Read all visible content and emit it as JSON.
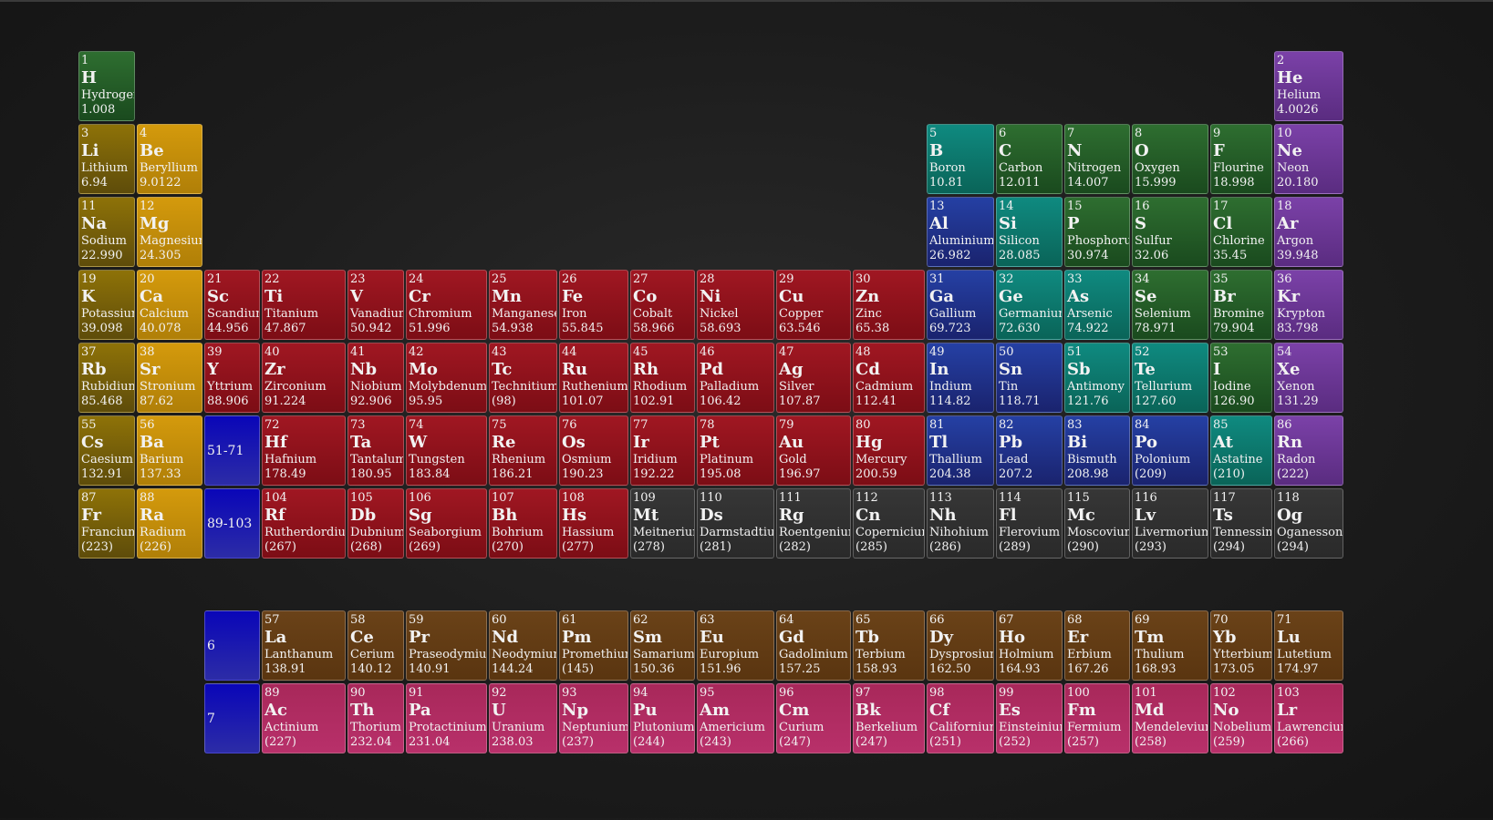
{
  "colors": {
    "alkali": "#7a620a",
    "alkaline": "#c48c0a",
    "transition": "#8e1219",
    "post": "#1f2d8a",
    "metalloid": "#0d7a6e",
    "nonmetal": "#245c26",
    "noble": "#6a3694",
    "unknown": "#303030",
    "lanthanide": "#603c14",
    "actinide": "#b02c62",
    "placeholder": "#1a18b0"
  },
  "placeholders": [
    {
      "id": "lanthanides-range",
      "label": "51-71",
      "row": 6,
      "col": 3
    },
    {
      "id": "actinides-range",
      "label": "89-103",
      "row": 7,
      "col": 3
    },
    {
      "id": "lanthanide-row",
      "label": "6",
      "row": 9,
      "col": 3
    },
    {
      "id": "actinide-row",
      "label": "7",
      "row": 10,
      "col": 3
    }
  ],
  "elements": [
    {
      "n": "1",
      "s": "H",
      "name": "Hydrogen",
      "m": "1.008",
      "row": 1,
      "col": 1,
      "cat": "nonmetal"
    },
    {
      "n": "2",
      "s": "He",
      "name": "Helium",
      "m": "4.0026",
      "row": 1,
      "col": 18,
      "cat": "noble"
    },
    {
      "n": "3",
      "s": "Li",
      "name": "Lithium",
      "m": "6.94",
      "row": 2,
      "col": 1,
      "cat": "alkali"
    },
    {
      "n": "4",
      "s": "Be",
      "name": "Beryllium",
      "m": "9.0122",
      "row": 2,
      "col": 2,
      "cat": "alkaline"
    },
    {
      "n": "5",
      "s": "B",
      "name": "Boron",
      "m": "10.81",
      "row": 2,
      "col": 13,
      "cat": "metalloid"
    },
    {
      "n": "6",
      "s": "C",
      "name": "Carbon",
      "m": "12.011",
      "row": 2,
      "col": 14,
      "cat": "nonmetal"
    },
    {
      "n": "7",
      "s": "N",
      "name": "Nitrogen",
      "m": "14.007",
      "row": 2,
      "col": 15,
      "cat": "nonmetal"
    },
    {
      "n": "8",
      "s": "O",
      "name": "Oxygen",
      "m": "15.999",
      "row": 2,
      "col": 16,
      "cat": "nonmetal"
    },
    {
      "n": "9",
      "s": "F",
      "name": "Flourine",
      "m": "18.998",
      "row": 2,
      "col": 17,
      "cat": "nonmetal"
    },
    {
      "n": "10",
      "s": "Ne",
      "name": "Neon",
      "m": "20.180",
      "row": 2,
      "col": 18,
      "cat": "noble"
    },
    {
      "n": "11",
      "s": "Na",
      "name": "Sodium",
      "m": "22.990",
      "row": 3,
      "col": 1,
      "cat": "alkali"
    },
    {
      "n": "12",
      "s": "Mg",
      "name": "Magnesium",
      "m": "24.305",
      "row": 3,
      "col": 2,
      "cat": "alkaline"
    },
    {
      "n": "13",
      "s": "Al",
      "name": "Aluminium",
      "m": "26.982",
      "row": 3,
      "col": 13,
      "cat": "post"
    },
    {
      "n": "14",
      "s": "Si",
      "name": "Silicon",
      "m": "28.085",
      "row": 3,
      "col": 14,
      "cat": "metalloid"
    },
    {
      "n": "15",
      "s": "P",
      "name": "Phosphorus",
      "m": "30.974",
      "row": 3,
      "col": 15,
      "cat": "nonmetal"
    },
    {
      "n": "16",
      "s": "S",
      "name": "Sulfur",
      "m": "32.06",
      "row": 3,
      "col": 16,
      "cat": "nonmetal"
    },
    {
      "n": "17",
      "s": "Cl",
      "name": "Chlorine",
      "m": "35.45",
      "row": 3,
      "col": 17,
      "cat": "nonmetal"
    },
    {
      "n": "18",
      "s": "Ar",
      "name": "Argon",
      "m": "39.948",
      "row": 3,
      "col": 18,
      "cat": "noble"
    },
    {
      "n": "19",
      "s": "K",
      "name": "Potassium",
      "m": "39.098",
      "row": 4,
      "col": 1,
      "cat": "alkali"
    },
    {
      "n": "20",
      "s": "Ca",
      "name": "Calcium",
      "m": "40.078",
      "row": 4,
      "col": 2,
      "cat": "alkaline"
    },
    {
      "n": "21",
      "s": "Sc",
      "name": "Scandium",
      "m": "44.956",
      "row": 4,
      "col": 3,
      "cat": "transition"
    },
    {
      "n": "22",
      "s": "Ti",
      "name": "Titanium",
      "m": "47.867",
      "row": 4,
      "col": 4,
      "cat": "transition"
    },
    {
      "n": "23",
      "s": "V",
      "name": "Vanadium",
      "m": "50.942",
      "row": 4,
      "col": 5,
      "cat": "transition"
    },
    {
      "n": "24",
      "s": "Cr",
      "name": "Chromium",
      "m": "51.996",
      "row": 4,
      "col": 6,
      "cat": "transition"
    },
    {
      "n": "25",
      "s": "Mn",
      "name": "Manganese",
      "m": "54.938",
      "row": 4,
      "col": 7,
      "cat": "transition"
    },
    {
      "n": "26",
      "s": "Fe",
      "name": "Iron",
      "m": "55.845",
      "row": 4,
      "col": 8,
      "cat": "transition"
    },
    {
      "n": "27",
      "s": "Co",
      "name": "Cobalt",
      "m": "58.966",
      "row": 4,
      "col": 9,
      "cat": "transition"
    },
    {
      "n": "28",
      "s": "Ni",
      "name": "Nickel",
      "m": "58.693",
      "row": 4,
      "col": 10,
      "cat": "transition"
    },
    {
      "n": "29",
      "s": "Cu",
      "name": "Copper",
      "m": "63.546",
      "row": 4,
      "col": 11,
      "cat": "transition"
    },
    {
      "n": "30",
      "s": "Zn",
      "name": "Zinc",
      "m": "65.38",
      "row": 4,
      "col": 12,
      "cat": "transition"
    },
    {
      "n": "31",
      "s": "Ga",
      "name": "Gallium",
      "m": "69.723",
      "row": 4,
      "col": 13,
      "cat": "post"
    },
    {
      "n": "32",
      "s": "Ge",
      "name": "Germanium",
      "m": "72.630",
      "row": 4,
      "col": 14,
      "cat": "metalloid"
    },
    {
      "n": "33",
      "s": "As",
      "name": "Arsenic",
      "m": "74.922",
      "row": 4,
      "col": 15,
      "cat": "metalloid"
    },
    {
      "n": "34",
      "s": "Se",
      "name": "Selenium",
      "m": "78.971",
      "row": 4,
      "col": 16,
      "cat": "nonmetal"
    },
    {
      "n": "35",
      "s": "Br",
      "name": "Bromine",
      "m": "79.904",
      "row": 4,
      "col": 17,
      "cat": "nonmetal"
    },
    {
      "n": "36",
      "s": "Kr",
      "name": "Krypton",
      "m": "83.798",
      "row": 4,
      "col": 18,
      "cat": "noble"
    },
    {
      "n": "37",
      "s": "Rb",
      "name": "Rubidium",
      "m": "85.468",
      "row": 5,
      "col": 1,
      "cat": "alkali"
    },
    {
      "n": "38",
      "s": "Sr",
      "name": "Stronium",
      "m": "87.62",
      "row": 5,
      "col": 2,
      "cat": "alkaline"
    },
    {
      "n": "39",
      "s": "Y",
      "name": "Yttrium",
      "m": "88.906",
      "row": 5,
      "col": 3,
      "cat": "transition"
    },
    {
      "n": "40",
      "s": "Zr",
      "name": "Zirconium",
      "m": "91.224",
      "row": 5,
      "col": 4,
      "cat": "transition"
    },
    {
      "n": "41",
      "s": "Nb",
      "name": "Niobium",
      "m": "92.906",
      "row": 5,
      "col": 5,
      "cat": "transition"
    },
    {
      "n": "42",
      "s": "Mo",
      "name": "Molybdenum",
      "m": "95.95",
      "row": 5,
      "col": 6,
      "cat": "transition"
    },
    {
      "n": "43",
      "s": "Tc",
      "name": "Technitium",
      "m": "(98)",
      "row": 5,
      "col": 7,
      "cat": "transition"
    },
    {
      "n": "44",
      "s": "Ru",
      "name": "Ruthenium",
      "m": "101.07",
      "row": 5,
      "col": 8,
      "cat": "transition"
    },
    {
      "n": "45",
      "s": "Rh",
      "name": "Rhodium",
      "m": "102.91",
      "row": 5,
      "col": 9,
      "cat": "transition"
    },
    {
      "n": "46",
      "s": "Pd",
      "name": "Palladium",
      "m": "106.42",
      "row": 5,
      "col": 10,
      "cat": "transition"
    },
    {
      "n": "47",
      "s": "Ag",
      "name": "Silver",
      "m": "107.87",
      "row": 5,
      "col": 11,
      "cat": "transition"
    },
    {
      "n": "48",
      "s": "Cd",
      "name": "Cadmium",
      "m": "112.41",
      "row": 5,
      "col": 12,
      "cat": "transition"
    },
    {
      "n": "49",
      "s": "In",
      "name": "Indium",
      "m": "114.82",
      "row": 5,
      "col": 13,
      "cat": "post"
    },
    {
      "n": "50",
      "s": "Sn",
      "name": "Tin",
      "m": "118.71",
      "row": 5,
      "col": 14,
      "cat": "post"
    },
    {
      "n": "51",
      "s": "Sb",
      "name": "Antimony",
      "m": "121.76",
      "row": 5,
      "col": 15,
      "cat": "metalloid"
    },
    {
      "n": "52",
      "s": "Te",
      "name": "Tellurium",
      "m": "127.60",
      "row": 5,
      "col": 16,
      "cat": "metalloid"
    },
    {
      "n": "53",
      "s": "I",
      "name": "Iodine",
      "m": "126.90",
      "row": 5,
      "col": 17,
      "cat": "nonmetal"
    },
    {
      "n": "54",
      "s": "Xe",
      "name": "Xenon",
      "m": "131.29",
      "row": 5,
      "col": 18,
      "cat": "noble"
    },
    {
      "n": "55",
      "s": "Cs",
      "name": "Caesium",
      "m": "132.91",
      "row": 6,
      "col": 1,
      "cat": "alkali"
    },
    {
      "n": "56",
      "s": "Ba",
      "name": "Barium",
      "m": "137.33",
      "row": 6,
      "col": 2,
      "cat": "alkaline"
    },
    {
      "n": "72",
      "s": "Hf",
      "name": "Hafnium",
      "m": "178.49",
      "row": 6,
      "col": 4,
      "cat": "transition"
    },
    {
      "n": "73",
      "s": "Ta",
      "name": "Tantalum",
      "m": "180.95",
      "row": 6,
      "col": 5,
      "cat": "transition"
    },
    {
      "n": "74",
      "s": "W",
      "name": "Tungsten",
      "m": "183.84",
      "row": 6,
      "col": 6,
      "cat": "transition"
    },
    {
      "n": "75",
      "s": "Re",
      "name": "Rhenium",
      "m": "186.21",
      "row": 6,
      "col": 7,
      "cat": "transition"
    },
    {
      "n": "76",
      "s": "Os",
      "name": "Osmium",
      "m": "190.23",
      "row": 6,
      "col": 8,
      "cat": "transition"
    },
    {
      "n": "77",
      "s": "Ir",
      "name": "Iridium",
      "m": "192.22",
      "row": 6,
      "col": 9,
      "cat": "transition"
    },
    {
      "n": "78",
      "s": "Pt",
      "name": "Platinum",
      "m": "195.08",
      "row": 6,
      "col": 10,
      "cat": "transition"
    },
    {
      "n": "79",
      "s": "Au",
      "name": "Gold",
      "m": "196.97",
      "row": 6,
      "col": 11,
      "cat": "transition"
    },
    {
      "n": "80",
      "s": "Hg",
      "name": "Mercury",
      "m": "200.59",
      "row": 6,
      "col": 12,
      "cat": "transition"
    },
    {
      "n": "81",
      "s": "Tl",
      "name": "Thallium",
      "m": "204.38",
      "row": 6,
      "col": 13,
      "cat": "post"
    },
    {
      "n": "82",
      "s": "Pb",
      "name": "Lead",
      "m": "207.2",
      "row": 6,
      "col": 14,
      "cat": "post"
    },
    {
      "n": "83",
      "s": "Bi",
      "name": "Bismuth",
      "m": "208.98",
      "row": 6,
      "col": 15,
      "cat": "post"
    },
    {
      "n": "84",
      "s": "Po",
      "name": "Polonium",
      "m": "(209)",
      "row": 6,
      "col": 16,
      "cat": "post"
    },
    {
      "n": "85",
      "s": "At",
      "name": "Astatine",
      "m": "(210)",
      "row": 6,
      "col": 17,
      "cat": "metalloid"
    },
    {
      "n": "86",
      "s": "Rn",
      "name": "Radon",
      "m": "(222)",
      "row": 6,
      "col": 18,
      "cat": "noble"
    },
    {
      "n": "87",
      "s": "Fr",
      "name": "Francium",
      "m": "(223)",
      "row": 7,
      "col": 1,
      "cat": "alkali"
    },
    {
      "n": "88",
      "s": "Ra",
      "name": "Radium",
      "m": "(226)",
      "row": 7,
      "col": 2,
      "cat": "alkaline"
    },
    {
      "n": "104",
      "s": "Rf",
      "name": "Rutherdordium",
      "m": "(267)",
      "row": 7,
      "col": 4,
      "cat": "transition"
    },
    {
      "n": "105",
      "s": "Db",
      "name": "Dubnium",
      "m": "(268)",
      "row": 7,
      "col": 5,
      "cat": "transition"
    },
    {
      "n": "106",
      "s": "Sg",
      "name": "Seaborgium",
      "m": "(269)",
      "row": 7,
      "col": 6,
      "cat": "transition"
    },
    {
      "n": "107",
      "s": "Bh",
      "name": "Bohrium",
      "m": "(270)",
      "row": 7,
      "col": 7,
      "cat": "transition"
    },
    {
      "n": "108",
      "s": "Hs",
      "name": "Hassium",
      "m": "(277)",
      "row": 7,
      "col": 8,
      "cat": "transition"
    },
    {
      "n": "109",
      "s": "Mt",
      "name": "Meitnerium",
      "m": "(278)",
      "row": 7,
      "col": 9,
      "cat": "unknown"
    },
    {
      "n": "110",
      "s": "Ds",
      "name": "Darmstadtium",
      "m": "(281)",
      "row": 7,
      "col": 10,
      "cat": "unknown"
    },
    {
      "n": "111",
      "s": "Rg",
      "name": "Roentgenium",
      "m": "(282)",
      "row": 7,
      "col": 11,
      "cat": "unknown"
    },
    {
      "n": "112",
      "s": "Cn",
      "name": "Copernicium",
      "m": "(285)",
      "row": 7,
      "col": 12,
      "cat": "unknown"
    },
    {
      "n": "113",
      "s": "Nh",
      "name": "Nihohium",
      "m": "(286)",
      "row": 7,
      "col": 13,
      "cat": "unknown"
    },
    {
      "n": "114",
      "s": "Fl",
      "name": "Flerovium",
      "m": "(289)",
      "row": 7,
      "col": 14,
      "cat": "unknown"
    },
    {
      "n": "115",
      "s": "Mc",
      "name": "Moscovium",
      "m": "(290)",
      "row": 7,
      "col": 15,
      "cat": "unknown"
    },
    {
      "n": "116",
      "s": "Lv",
      "name": "Livermorium",
      "m": "(293)",
      "row": 7,
      "col": 16,
      "cat": "unknown"
    },
    {
      "n": "117",
      "s": "Ts",
      "name": "Tennessine",
      "m": "(294)",
      "row": 7,
      "col": 17,
      "cat": "unknown"
    },
    {
      "n": "118",
      "s": "Og",
      "name": "Oganesson",
      "m": "(294)",
      "row": 7,
      "col": 18,
      "cat": "unknown"
    },
    {
      "n": "57",
      "s": "La",
      "name": "Lanthanum",
      "m": "138.91",
      "row": 9,
      "col": 4,
      "cat": "lanthanide"
    },
    {
      "n": "58",
      "s": "Ce",
      "name": "Cerium",
      "m": "140.12",
      "row": 9,
      "col": 5,
      "cat": "lanthanide"
    },
    {
      "n": "59",
      "s": "Pr",
      "name": "Praseodymium",
      "m": "140.91",
      "row": 9,
      "col": 6,
      "cat": "lanthanide"
    },
    {
      "n": "60",
      "s": "Nd",
      "name": "Neodymium",
      "m": "144.24",
      "row": 9,
      "col": 7,
      "cat": "lanthanide"
    },
    {
      "n": "61",
      "s": "Pm",
      "name": "Promethium",
      "m": "(145)",
      "row": 9,
      "col": 8,
      "cat": "lanthanide"
    },
    {
      "n": "62",
      "s": "Sm",
      "name": "Samarium",
      "m": "150.36",
      "row": 9,
      "col": 9,
      "cat": "lanthanide"
    },
    {
      "n": "63",
      "s": "Eu",
      "name": "Europium",
      "m": "151.96",
      "row": 9,
      "col": 10,
      "cat": "lanthanide"
    },
    {
      "n": "64",
      "s": "Gd",
      "name": "Gadolinium",
      "m": "157.25",
      "row": 9,
      "col": 11,
      "cat": "lanthanide"
    },
    {
      "n": "65",
      "s": "Tb",
      "name": "Terbium",
      "m": "158.93",
      "row": 9,
      "col": 12,
      "cat": "lanthanide"
    },
    {
      "n": "66",
      "s": "Dy",
      "name": "Dysprosium",
      "m": "162.50",
      "row": 9,
      "col": 13,
      "cat": "lanthanide"
    },
    {
      "n": "67",
      "s": "Ho",
      "name": "Holmium",
      "m": "164.93",
      "row": 9,
      "col": 14,
      "cat": "lanthanide"
    },
    {
      "n": "68",
      "s": "Er",
      "name": "Erbium",
      "m": "167.26",
      "row": 9,
      "col": 15,
      "cat": "lanthanide"
    },
    {
      "n": "69",
      "s": "Tm",
      "name": "Thulium",
      "m": "168.93",
      "row": 9,
      "col": 16,
      "cat": "lanthanide"
    },
    {
      "n": "70",
      "s": "Yb",
      "name": "Ytterbium",
      "m": "173.05",
      "row": 9,
      "col": 17,
      "cat": "lanthanide"
    },
    {
      "n": "71",
      "s": "Lu",
      "name": "Lutetium",
      "m": "174.97",
      "row": 9,
      "col": 18,
      "cat": "lanthanide"
    },
    {
      "n": "89",
      "s": "Ac",
      "name": "Actinium",
      "m": "(227)",
      "row": 10,
      "col": 4,
      "cat": "actinide"
    },
    {
      "n": "90",
      "s": "Th",
      "name": "Thorium",
      "m": "232.04",
      "row": 10,
      "col": 5,
      "cat": "actinide"
    },
    {
      "n": "91",
      "s": "Pa",
      "name": "Protactinium",
      "m": "231.04",
      "row": 10,
      "col": 6,
      "cat": "actinide"
    },
    {
      "n": "92",
      "s": "U",
      "name": "Uranium",
      "m": "238.03",
      "row": 10,
      "col": 7,
      "cat": "actinide"
    },
    {
      "n": "93",
      "s": "Np",
      "name": "Neptunium",
      "m": "(237)",
      "row": 10,
      "col": 8,
      "cat": "actinide"
    },
    {
      "n": "94",
      "s": "Pu",
      "name": "Plutonium",
      "m": "(244)",
      "row": 10,
      "col": 9,
      "cat": "actinide"
    },
    {
      "n": "95",
      "s": "Am",
      "name": "Americium",
      "m": "(243)",
      "row": 10,
      "col": 10,
      "cat": "actinide"
    },
    {
      "n": "96",
      "s": "Cm",
      "name": "Curium",
      "m": "(247)",
      "row": 10,
      "col": 11,
      "cat": "actinide"
    },
    {
      "n": "97",
      "s": "Bk",
      "name": "Berkelium",
      "m": "(247)",
      "row": 10,
      "col": 12,
      "cat": "actinide"
    },
    {
      "n": "98",
      "s": "Cf",
      "name": "Californium",
      "m": "(251)",
      "row": 10,
      "col": 13,
      "cat": "actinide"
    },
    {
      "n": "99",
      "s": "Es",
      "name": "Einsteinium",
      "m": "(252)",
      "row": 10,
      "col": 14,
      "cat": "actinide"
    },
    {
      "n": "100",
      "s": "Fm",
      "name": "Fermium",
      "m": "(257)",
      "row": 10,
      "col": 15,
      "cat": "actinide"
    },
    {
      "n": "101",
      "s": "Md",
      "name": "Mendelevium",
      "m": "(258)",
      "row": 10,
      "col": 16,
      "cat": "actinide"
    },
    {
      "n": "102",
      "s": "No",
      "name": "Nobelium",
      "m": "(259)",
      "row": 10,
      "col": 17,
      "cat": "actinide"
    },
    {
      "n": "103",
      "s": "Lr",
      "name": "Lawrencium",
      "m": "(266)",
      "row": 10,
      "col": 18,
      "cat": "actinide"
    }
  ]
}
